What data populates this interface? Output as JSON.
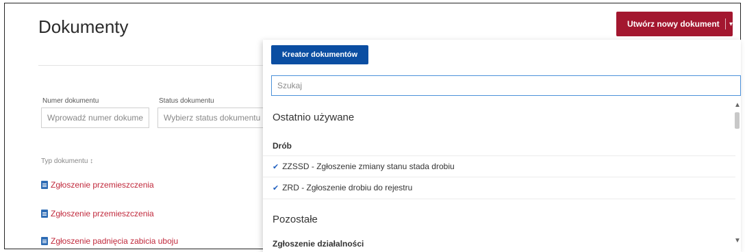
{
  "page": {
    "title": "Dokumenty"
  },
  "create_button": {
    "label": "Utwórz nowy dokument",
    "caret": "▾"
  },
  "filters": {
    "number": {
      "label": "Numer dokumentu",
      "placeholder": "Wprowadź numer dokume"
    },
    "status": {
      "label": "Status dokumentu",
      "placeholder": "Wybierz status dokumentu"
    }
  },
  "table": {
    "header": "Typ dokumentu ↕",
    "rows": [
      {
        "label": "Zgłoszenie przemieszczenia"
      },
      {
        "label": "Zgłoszenie przemieszczenia"
      },
      {
        "label": "Zgłoszenie padnięcia zabicia uboju"
      }
    ]
  },
  "dropdown": {
    "creator_button": "Kreator dokumentów",
    "search_placeholder": "Szukaj",
    "recent_title": "Ostatnio używane",
    "recent_group": "Drób",
    "recent_items": [
      {
        "label": "ZZSSD - Zgłoszenie zmiany stanu stada drobiu"
      },
      {
        "label": "ZRD - Zgłoszenie drobiu do rejestru"
      }
    ],
    "other_title": "Pozostałe",
    "other_group": "Zgłoszenie działalności"
  },
  "colors": {
    "accent": "#a3172f",
    "primary": "#0b4ea2",
    "link": "#c0283b"
  }
}
